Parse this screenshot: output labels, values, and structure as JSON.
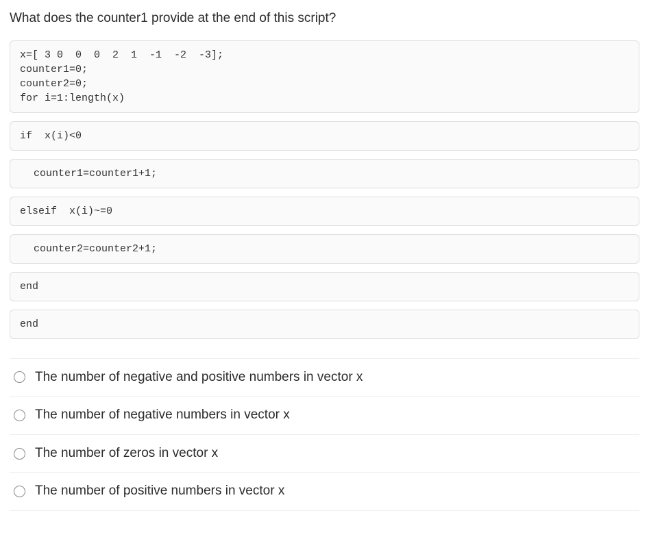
{
  "question": "What does the counter1 provide at the end of this script?",
  "code_blocks": [
    "x=[ 3 0  0  0  2  1  -1  -2  -3];\ncounter1=0;\ncounter2=0;\nfor i=1:length(x)",
    "if  x(i)<0",
    "counter1=counter1+1;",
    "elseif  x(i)~=0",
    "counter2=counter2+1;",
    "end",
    "end"
  ],
  "options": [
    "The number of negative and positive numbers in vector x",
    "The number of negative numbers in vector x",
    "The number of zeros in vector x",
    "The number of positive numbers in vector x"
  ]
}
